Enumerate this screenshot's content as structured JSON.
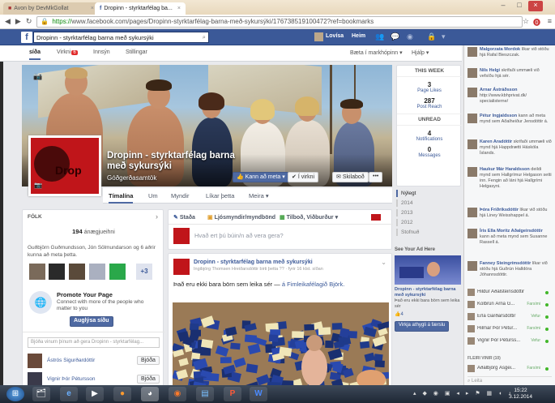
{
  "browser": {
    "tabs": [
      {
        "label": "Avon by DevMkGollat",
        "active": false
      },
      {
        "label": "Dropinn - styrktarfélag ba...",
        "active": true
      }
    ],
    "url_scheme": "https://",
    "url_rest": "www.facebook.com/pages/Dropinn-styrktarfélag-barna-með-sykursýki/176738519100472?ref=bookmarks"
  },
  "fb": {
    "search_value": "Dropinn - styrktarfélag barna með sykursýki",
    "user": "Lovísa",
    "home": "Heim"
  },
  "page_tabs": {
    "items": [
      {
        "label": "síða",
        "selected": true
      },
      {
        "label": "Virkni",
        "badge": "6"
      },
      {
        "label": "Innsýn"
      },
      {
        "label": "Stillingar"
      }
    ],
    "add_label": "Bæta í markhópinn",
    "help_label": "Hjálp"
  },
  "page": {
    "title": "Dropinn - styrktarfélag barna með sykursýki",
    "category": "Góðgerðasamtök",
    "avatar_text": "Drop",
    "buttons": {
      "liked": "Kann að meta",
      "following": "Í virkni",
      "message": "Skilaboð",
      "more": "•••"
    }
  },
  "subtabs": [
    "Tímalína",
    "Um",
    "Myndir",
    "Líkar þetta",
    "Meira"
  ],
  "this_week": {
    "header": "THIS WEEK",
    "page_likes": {
      "num": "3",
      "label": "Page Likes"
    },
    "post_reach": {
      "num": "287",
      "label": "Post Reach"
    },
    "unread_header": "UNREAD",
    "notifications": {
      "num": "4",
      "label": "Notifications"
    },
    "messages": {
      "num": "0",
      "label": "Messages"
    }
  },
  "years": [
    "Nýlegt",
    "2014",
    "2013",
    "2012",
    "Stofnuð"
  ],
  "likes_box": {
    "header": "FÓLK",
    "count": "194",
    "count_label": "ánægjueihni",
    "friends_text": "Guðbjörn Guðmundsson, Jón Sölmundarson og 6 aðrir kunna að meta þetta.",
    "plus": "+3",
    "promote_title": "Promote Your Page",
    "promote_text": "Connect with more of the people who matter to you",
    "promote_button": "Auglýsa síðu",
    "invite_placeholder": "Bjóða vinum þínum að gera Dropinn - styrktarfélag...",
    "invite": [
      {
        "name": "Ástrós Sigurðardóttir",
        "button": "Bjóða"
      },
      {
        "name": "Vignir Þór Pétursson",
        "button": "Bjóða"
      }
    ]
  },
  "composer": {
    "tabs": [
      "Staða",
      "Ljósmyndir/myndbönd",
      "Tilboð, Viðburður"
    ],
    "prompt": "Hvað ert þú búin/n að vera gera?"
  },
  "post": {
    "author": "Dropinn - styrktarfélag barna með sykursýki",
    "meta": "Ingibjörg Thomsen Hreiðarsdóttir birti þetta ?? · fyrir 16 klst. síðan",
    "text_prefix": "Það eru ekki bara börn sem leika sér —",
    "text_link": "á Fimleikafélagið Björk."
  },
  "ad": {
    "header": "See Your Ad Here",
    "title": "Dropinn - styrktarfélag barna með sykursýki",
    "text": "Það eru ekki bara börn sem leika sér",
    "likes": "4",
    "button": "Virkja athygli á færslu"
  },
  "ticker": [
    {
      "name": "Malgorzata Mordok",
      "text": "líkar við stöðu hjá Rafal Bieszczak."
    },
    {
      "name": "Nils Helgi",
      "text": "skrifaði ummæli við vefsíðu hjá sér."
    },
    {
      "name": "Arnar Ástráðsson",
      "text": "http://www.kbhprivat.dk/ specialisterne/"
    },
    {
      "name": "Pétur Ingjaldsson",
      "text": "kann að meta mynd sem Aðalheiður Jensdóttir á."
    },
    {
      "name": "Karen Aradóttir",
      "text": "skrifaði ummæli við mynd hjá Happdrætti Háskóla Íslands."
    },
    {
      "name": "Haukur Már Haraldsson",
      "text": "deildi mynd sem Hallgrímur Helgason setti inn. Fengin að láni hjá Hallgrími Helgasyni."
    },
    {
      "name": "Þóra Friðriksdóttir",
      "text": "líkar við stöðu hjá Liney Weisshappel á."
    },
    {
      "name": "Íris Ella Moritz Aðalgeirsdóttir",
      "text": "kann að meta mynd sem Susanne Rassell á."
    },
    {
      "name": "Fanney Steingrímsdóttir",
      "text": "líkar við stöðu hjá Guðrún Halldóra Jóhannsdóttir."
    }
  ],
  "chat": {
    "online": [
      {
        "name": "Hildur Aðalsteinsdóttir",
        "status": ""
      },
      {
        "name": "Kolbrún Árna G...",
        "status": "Farsími"
      },
      {
        "name": "Erla Garðarsdóttir",
        "status": "Vefur"
      },
      {
        "name": "Hilmar Þór Pétur...",
        "status": "Farsími"
      },
      {
        "name": "Vignir Þór Péturss...",
        "status": "Vefur"
      }
    ],
    "more_header": "FLEIRI VINIR (10)",
    "more": [
      {
        "name": "Aðalbjörg Ásgei...",
        "status": "Farsími"
      }
    ],
    "search": "Leita"
  },
  "taskbar": {
    "time": "15:22",
    "date": "3.12.2014"
  }
}
